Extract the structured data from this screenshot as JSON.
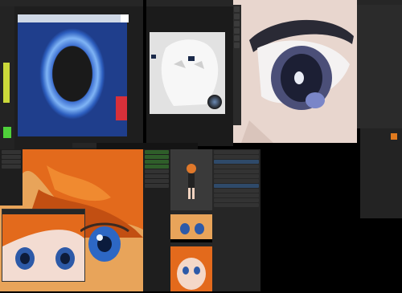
{
  "top_left_window": {
    "title_bar_text": "",
    "tab_label": "",
    "footer_text": ""
  },
  "right_sidebar": {
    "items": [
      "",
      "",
      "",
      "",
      "",
      "",
      "",
      "",
      "",
      "",
      "",
      "",
      "",
      "",
      "",
      "",
      "",
      "",
      "",
      "",
      "",
      "",
      "",
      ""
    ]
  },
  "center_tools": {
    "status_text": ""
  },
  "bottom_left_window": {
    "title": ""
  },
  "preview_window": {
    "title_top": "",
    "title_bottom": ""
  },
  "colors": {
    "accent_blue": "#2f6fb0",
    "accent_orange": "#e07a1e",
    "panel_dark": "#1e1e1e",
    "panel_mid": "#2b2b2b",
    "list_green": "#2f5e2a"
  }
}
